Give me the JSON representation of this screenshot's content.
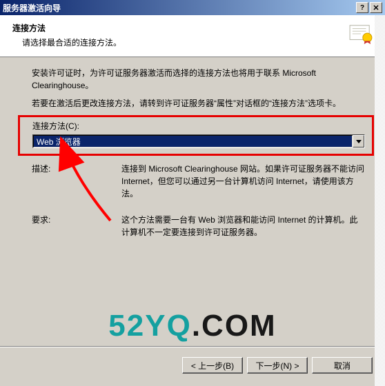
{
  "titlebar": {
    "title": "服务器激活向导",
    "help_aria": "Help",
    "close_aria": "Close"
  },
  "header": {
    "title": "连接方法",
    "subtitle": "请选择最合适的连接方法。"
  },
  "content": {
    "para1": "安装许可证时，为许可证服务器激活而选择的连接方法也将用于联系 Microsoft Clearinghouse。",
    "para2": "若要在激活后更改连接方法，请转到许可证服务器“属性”对话框的“连接方法”选项卡。",
    "connect_label": "连接方法(C):",
    "connect_value": "Web 浏览器",
    "desc_label": "描述:",
    "desc_value": "连接到 Microsoft Clearinghouse 网站。如果许可证服务器不能访问 Internet，但您可以通过另一台计算机访问 Internet，请使用该方法。",
    "req_label": "要求:",
    "req_value": "这个方法需要一台有 Web 浏览器和能访问 Internet 的计算机。此计算机不一定要连接到许可证服务器。"
  },
  "buttons": {
    "back": "< 上一步(B)",
    "next": "下一步(N) >",
    "cancel": "取消"
  },
  "watermark": {
    "part1": "52YQ",
    "part2": ".COM"
  },
  "colors": {
    "titlebar_start": "#0a246a",
    "titlebar_end": "#a6caf0",
    "redbox": "#e60000",
    "arrow": "#ff0000",
    "wm_teal": "#14a0a0"
  }
}
